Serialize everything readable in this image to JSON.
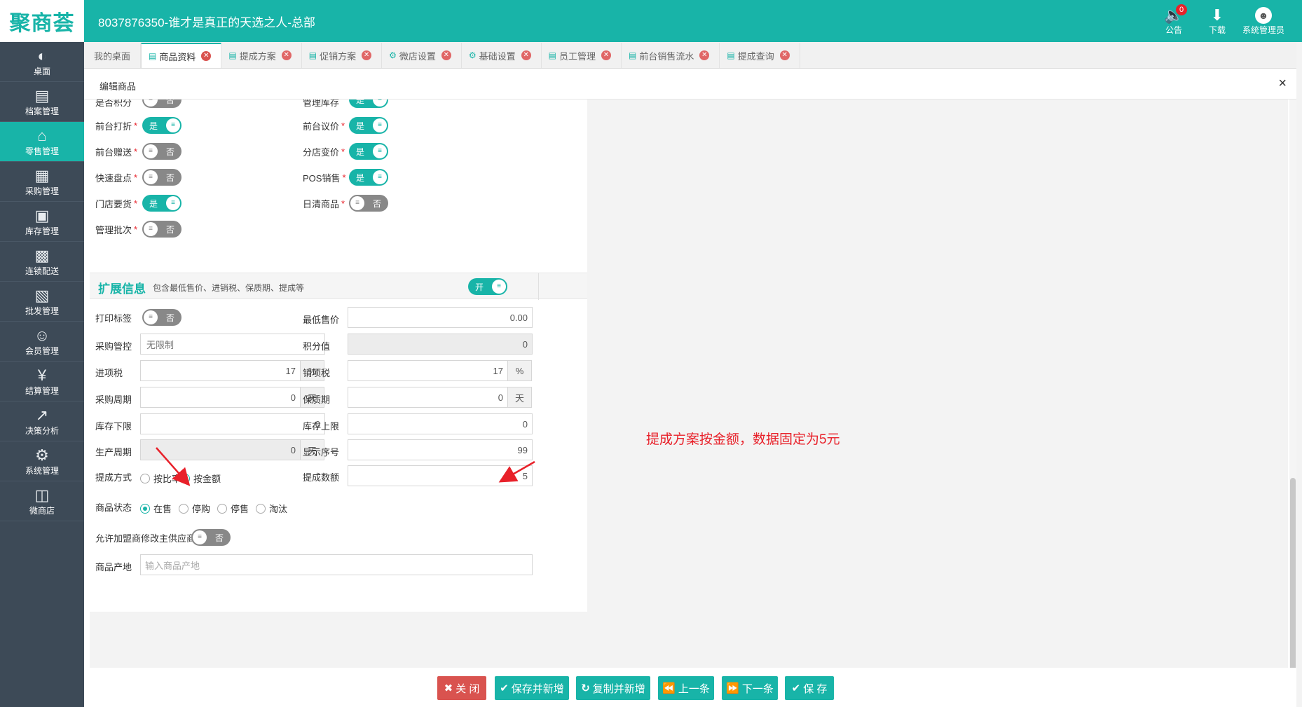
{
  "app": {
    "logo": "聚商荟",
    "title": "8037876350-谁才是真正的天选之人-总部"
  },
  "header_tools": {
    "notice_label": "公告",
    "notice_count": "0",
    "download_label": "下载",
    "user_label": "系统管理员"
  },
  "sidebar": {
    "items": [
      {
        "label": "桌面",
        "icon": "dashboard-icon"
      },
      {
        "label": "档案管理",
        "icon": "archive-icon"
      },
      {
        "label": "零售管理",
        "icon": "store-icon",
        "active": true
      },
      {
        "label": "采购管理",
        "icon": "cart-icon"
      },
      {
        "label": "库存管理",
        "icon": "inventory-icon"
      },
      {
        "label": "连锁配送",
        "icon": "truck-icon"
      },
      {
        "label": "批发管理",
        "icon": "wholesale-icon"
      },
      {
        "label": "会员管理",
        "icon": "member-icon"
      },
      {
        "label": "结算管理",
        "icon": "settlement-icon"
      },
      {
        "label": "决策分析",
        "icon": "chart-icon"
      },
      {
        "label": "系统管理",
        "icon": "gear-icon"
      },
      {
        "label": "微商店",
        "icon": "shop-bag-icon"
      }
    ]
  },
  "tabs": [
    {
      "label": "我的桌面"
    },
    {
      "label": "商品资料",
      "active": true
    },
    {
      "label": "提成方案"
    },
    {
      "label": "促销方案"
    },
    {
      "label": "微店设置"
    },
    {
      "label": "基础设置"
    },
    {
      "label": "员工管理"
    },
    {
      "label": "前台销售流水"
    },
    {
      "label": "提成查询"
    }
  ],
  "dialog": {
    "title": "编辑商品",
    "close": "×"
  },
  "toggles": {
    "on_text": "是",
    "off_text": "否",
    "open_text": "开",
    "score": {
      "label": "是否积分"
    },
    "stock_mgmt": {
      "label": "管理库存"
    },
    "front_discount": {
      "label": "前台打折"
    },
    "front_bargain": {
      "label": "前台议价"
    },
    "front_gift": {
      "label": "前台赠送"
    },
    "branch_price": {
      "label": "分店变价"
    },
    "quick_check": {
      "label": "快速盘点"
    },
    "pos_sale": {
      "label": "POS销售"
    },
    "store_order": {
      "label": "门店要货"
    },
    "daily_clear": {
      "label": "日清商品"
    },
    "batch_mgmt": {
      "label": "管理批次"
    }
  },
  "section": {
    "title": "扩展信息",
    "subtitle": "包含最低售价、进销税、保质期、提成等"
  },
  "fields": {
    "print_label": {
      "label": "打印标签"
    },
    "min_price": {
      "label": "最低售价",
      "value": "0.00"
    },
    "purchase_ctrl": {
      "label": "采购管控",
      "value": "无限制"
    },
    "points": {
      "label": "积分值",
      "value": "0"
    },
    "input_tax": {
      "label": "进项税",
      "value": "17",
      "unit": "%"
    },
    "output_tax": {
      "label": "销项税",
      "value": "17",
      "unit": "%"
    },
    "purchase_cycle": {
      "label": "采购周期",
      "value": "0",
      "unit": "天"
    },
    "shelf_life": {
      "label": "保质期",
      "value": "0",
      "unit": "天"
    },
    "stock_min": {
      "label": "库存下限",
      "value": "0"
    },
    "stock_max": {
      "label": "库存上限",
      "value": "0"
    },
    "prod_cycle": {
      "label": "生产周期",
      "value": "0",
      "unit": "天"
    },
    "display_order": {
      "label": "显示序号",
      "value": "99"
    },
    "commission_mode": {
      "label": "提成方式",
      "options": [
        "按比率",
        "按金额"
      ]
    },
    "commission_value": {
      "label": "提成数额",
      "value": "5"
    },
    "status": {
      "label": "商品状态",
      "options": [
        "在售",
        "停购",
        "停售",
        "淘汰"
      ]
    },
    "franchise_supplier": {
      "label": "允许加盟商修改主供应商"
    },
    "origin": {
      "label": "商品产地",
      "placeholder": "输入商品产地"
    }
  },
  "annotation": "提成方案按金额，数据固定为5元",
  "buttons": {
    "close": "关 闭",
    "save_new": "保存并新增",
    "copy_new": "复制并新增",
    "prev": "上一条",
    "next": "下一条",
    "save": "保 存"
  },
  "colors": {
    "accent": "#18b4a8",
    "sidebar": "#3d4a57",
    "danger": "#d9534f",
    "annotation": "#e8212a"
  }
}
